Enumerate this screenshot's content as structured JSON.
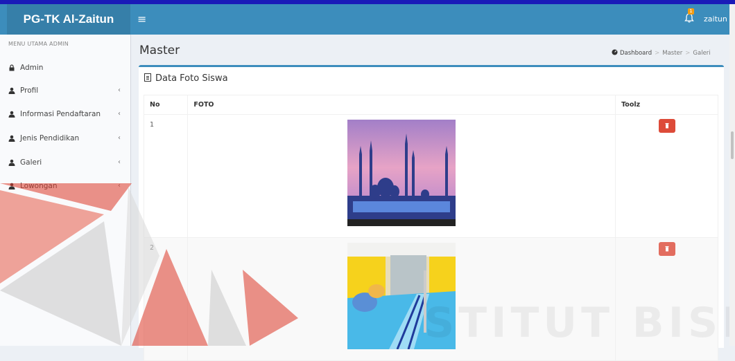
{
  "header": {
    "logo": "PG-TK Al-Zaitun",
    "menu_toggle": "≡",
    "notification_count": "1",
    "username": "zaitun"
  },
  "sidebar": {
    "header": "MENU UTAMA ADMIN",
    "items": [
      {
        "label": "Admin",
        "icon": "lock-icon",
        "has_submenu": false
      },
      {
        "label": "Profil",
        "icon": "user-icon",
        "has_submenu": true
      },
      {
        "label": "Informasi Pendaftaran",
        "icon": "user-icon",
        "has_submenu": true
      },
      {
        "label": "Jenis Pendidikan",
        "icon": "user-icon",
        "has_submenu": true
      },
      {
        "label": "Galeri",
        "icon": "user-icon",
        "has_submenu": true
      },
      {
        "label": "Lowongan",
        "icon": "user-icon",
        "has_submenu": true
      }
    ],
    "chevron": "‹"
  },
  "content": {
    "title": "Master",
    "breadcrumb": [
      "Dashboard",
      "Master",
      "Galeri"
    ]
  },
  "box": {
    "title": "Data Foto Siswa",
    "columns": [
      "No",
      "FOTO",
      "Toolz"
    ],
    "rows": [
      {
        "no": "1",
        "photo": "mosque-photo"
      },
      {
        "no": "2",
        "photo": "swimming-pool-photo"
      }
    ]
  },
  "watermark": {
    "text": "STITUT BISNIS"
  },
  "colors": {
    "header": "#3c8dbc",
    "logo_bg": "#367fa9",
    "delete": "#dd4b39",
    "watermark": "#dd3a2a"
  }
}
